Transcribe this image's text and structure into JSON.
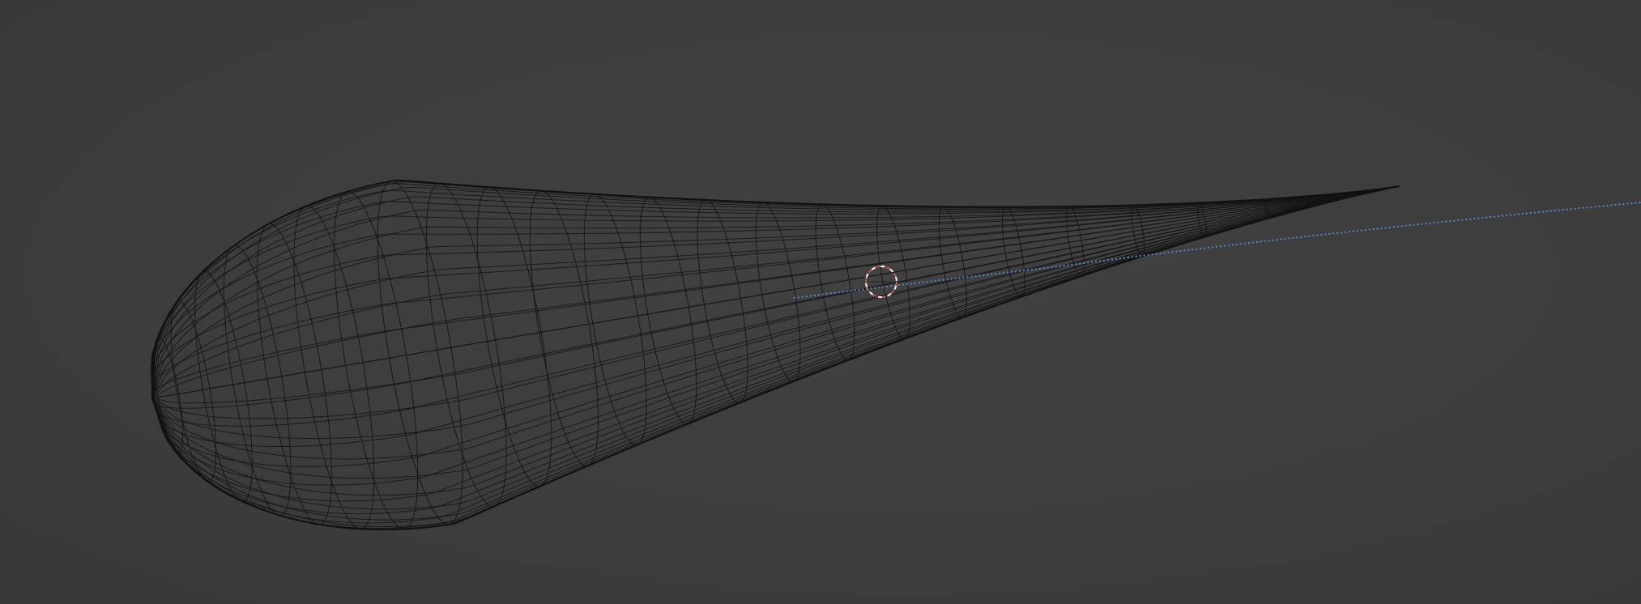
{
  "viewport": {
    "background": "#3d3d3d",
    "mode": "wireframe"
  },
  "mesh": {
    "name": "teardrop-wireframe",
    "wire_color": "#141414",
    "rings": 24,
    "segments": 40
  },
  "curve": {
    "name": "dotted-path",
    "color": "#5b86c9"
  },
  "cursor": {
    "name": "3d-cursor",
    "ring_colors": [
      "#c75757",
      "#ffffff"
    ]
  }
}
